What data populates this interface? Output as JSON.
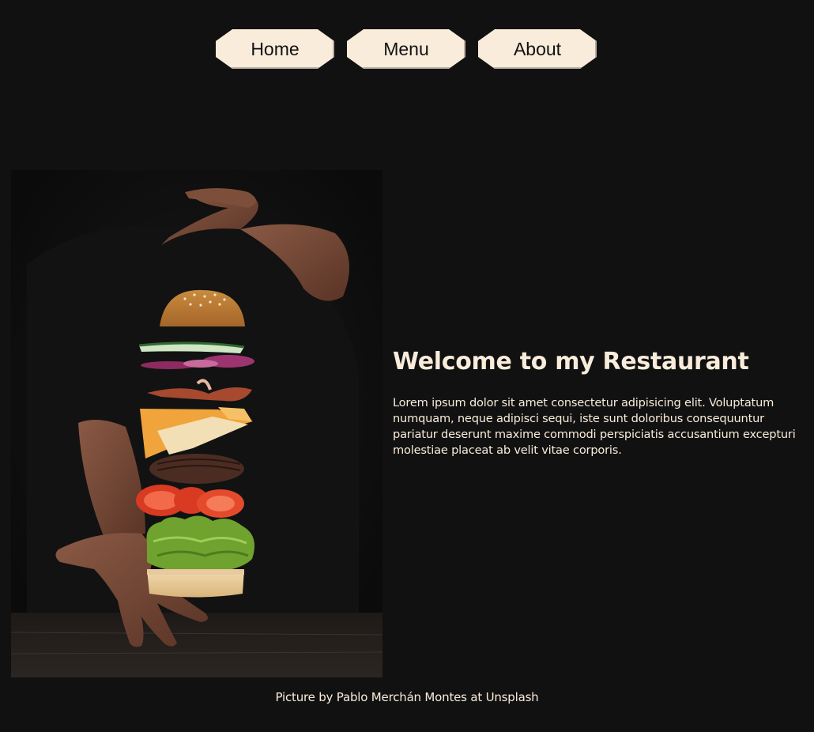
{
  "nav": {
    "items": [
      {
        "label": "Home"
      },
      {
        "label": "Menu"
      },
      {
        "label": "About"
      }
    ]
  },
  "hero": {
    "image_subject": "floating-burger-ingredients-between-hands"
  },
  "content": {
    "title": "Welcome to my Restaurant",
    "body": "Lorem ipsum dolor sit amet consectetur adipisicing elit. Voluptatum numquam, neque adipisci sequi, iste sunt doloribus consequuntur pariatur deserunt maxime commodi perspiciatis accusantium excepturi molestiae placeat ab velit vitae corporis."
  },
  "footer": {
    "credit": "Picture by Pablo Merchán Montes at Unsplash"
  },
  "colors": {
    "background": "#111111",
    "accent": "#f9ecdb"
  }
}
